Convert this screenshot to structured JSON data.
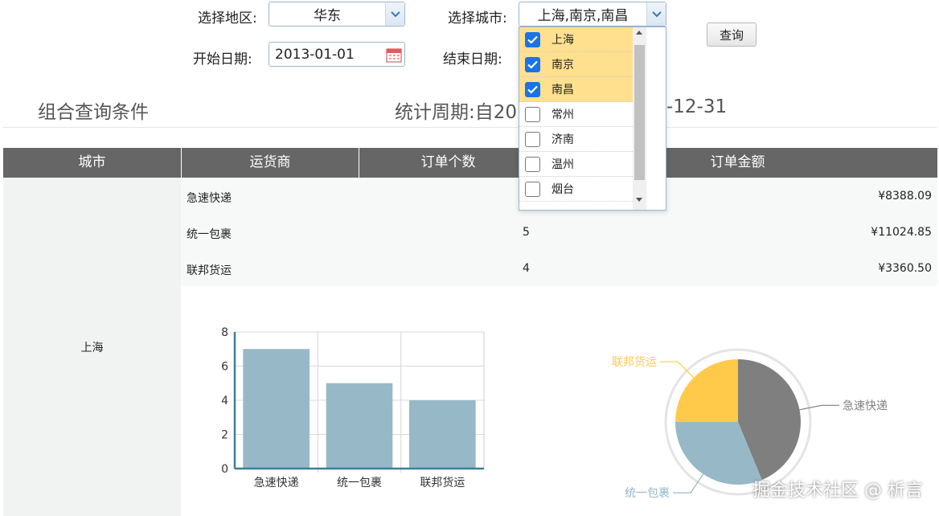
{
  "filters": {
    "region_label": "选择地区:",
    "region_value": "华东",
    "city_label": "选择城市:",
    "city_value": "上海,南京,南昌",
    "start_label": "开始日期:",
    "start_value": "2013-01-01",
    "end_label": "结束日期:",
    "query_button": "查询"
  },
  "city_dropdown": {
    "options": [
      {
        "label": "上海",
        "checked": true
      },
      {
        "label": "南京",
        "checked": true
      },
      {
        "label": "南昌",
        "checked": true
      },
      {
        "label": "常州",
        "checked": false
      },
      {
        "label": "济南",
        "checked": false
      },
      {
        "label": "温州",
        "checked": false
      },
      {
        "label": "烟台",
        "checked": false
      }
    ]
  },
  "section": {
    "title": "组合查询条件",
    "period_prefix": "统计周期:自20",
    "period_suffix": "-12-31"
  },
  "table": {
    "headers": [
      "城市",
      "运货商",
      "订单个数",
      "订单金额"
    ],
    "city": "上海",
    "rows": [
      {
        "carrier": "急速快递",
        "count": "",
        "amount": "¥8388.09"
      },
      {
        "carrier": "统一包裹",
        "count": "5",
        "amount": "¥11024.85"
      },
      {
        "carrier": "联邦货运",
        "count": "4",
        "amount": "¥3360.50"
      }
    ]
  },
  "chart_data": [
    {
      "type": "bar",
      "categories": [
        "急速快递",
        "统一包裹",
        "联邦货运"
      ],
      "values": [
        7,
        5,
        4
      ],
      "ylim": [
        0,
        8
      ],
      "yticks": [
        "0",
        "2",
        "4",
        "6",
        "8"
      ],
      "bar_color": "#97b8c7",
      "grid": true
    },
    {
      "type": "pie",
      "labels": [
        "急速快递",
        "统一包裹",
        "联邦货运"
      ],
      "values": [
        7,
        5,
        4
      ],
      "colors": [
        "#7f7f7f",
        "#97b8c7",
        "#ffc94a"
      ]
    }
  ],
  "watermark": "掘金技术社区 @ 析言",
  "icons": {
    "chevron": "chevron-down-icon",
    "calendar": "calendar-icon",
    "check": "check-icon"
  }
}
